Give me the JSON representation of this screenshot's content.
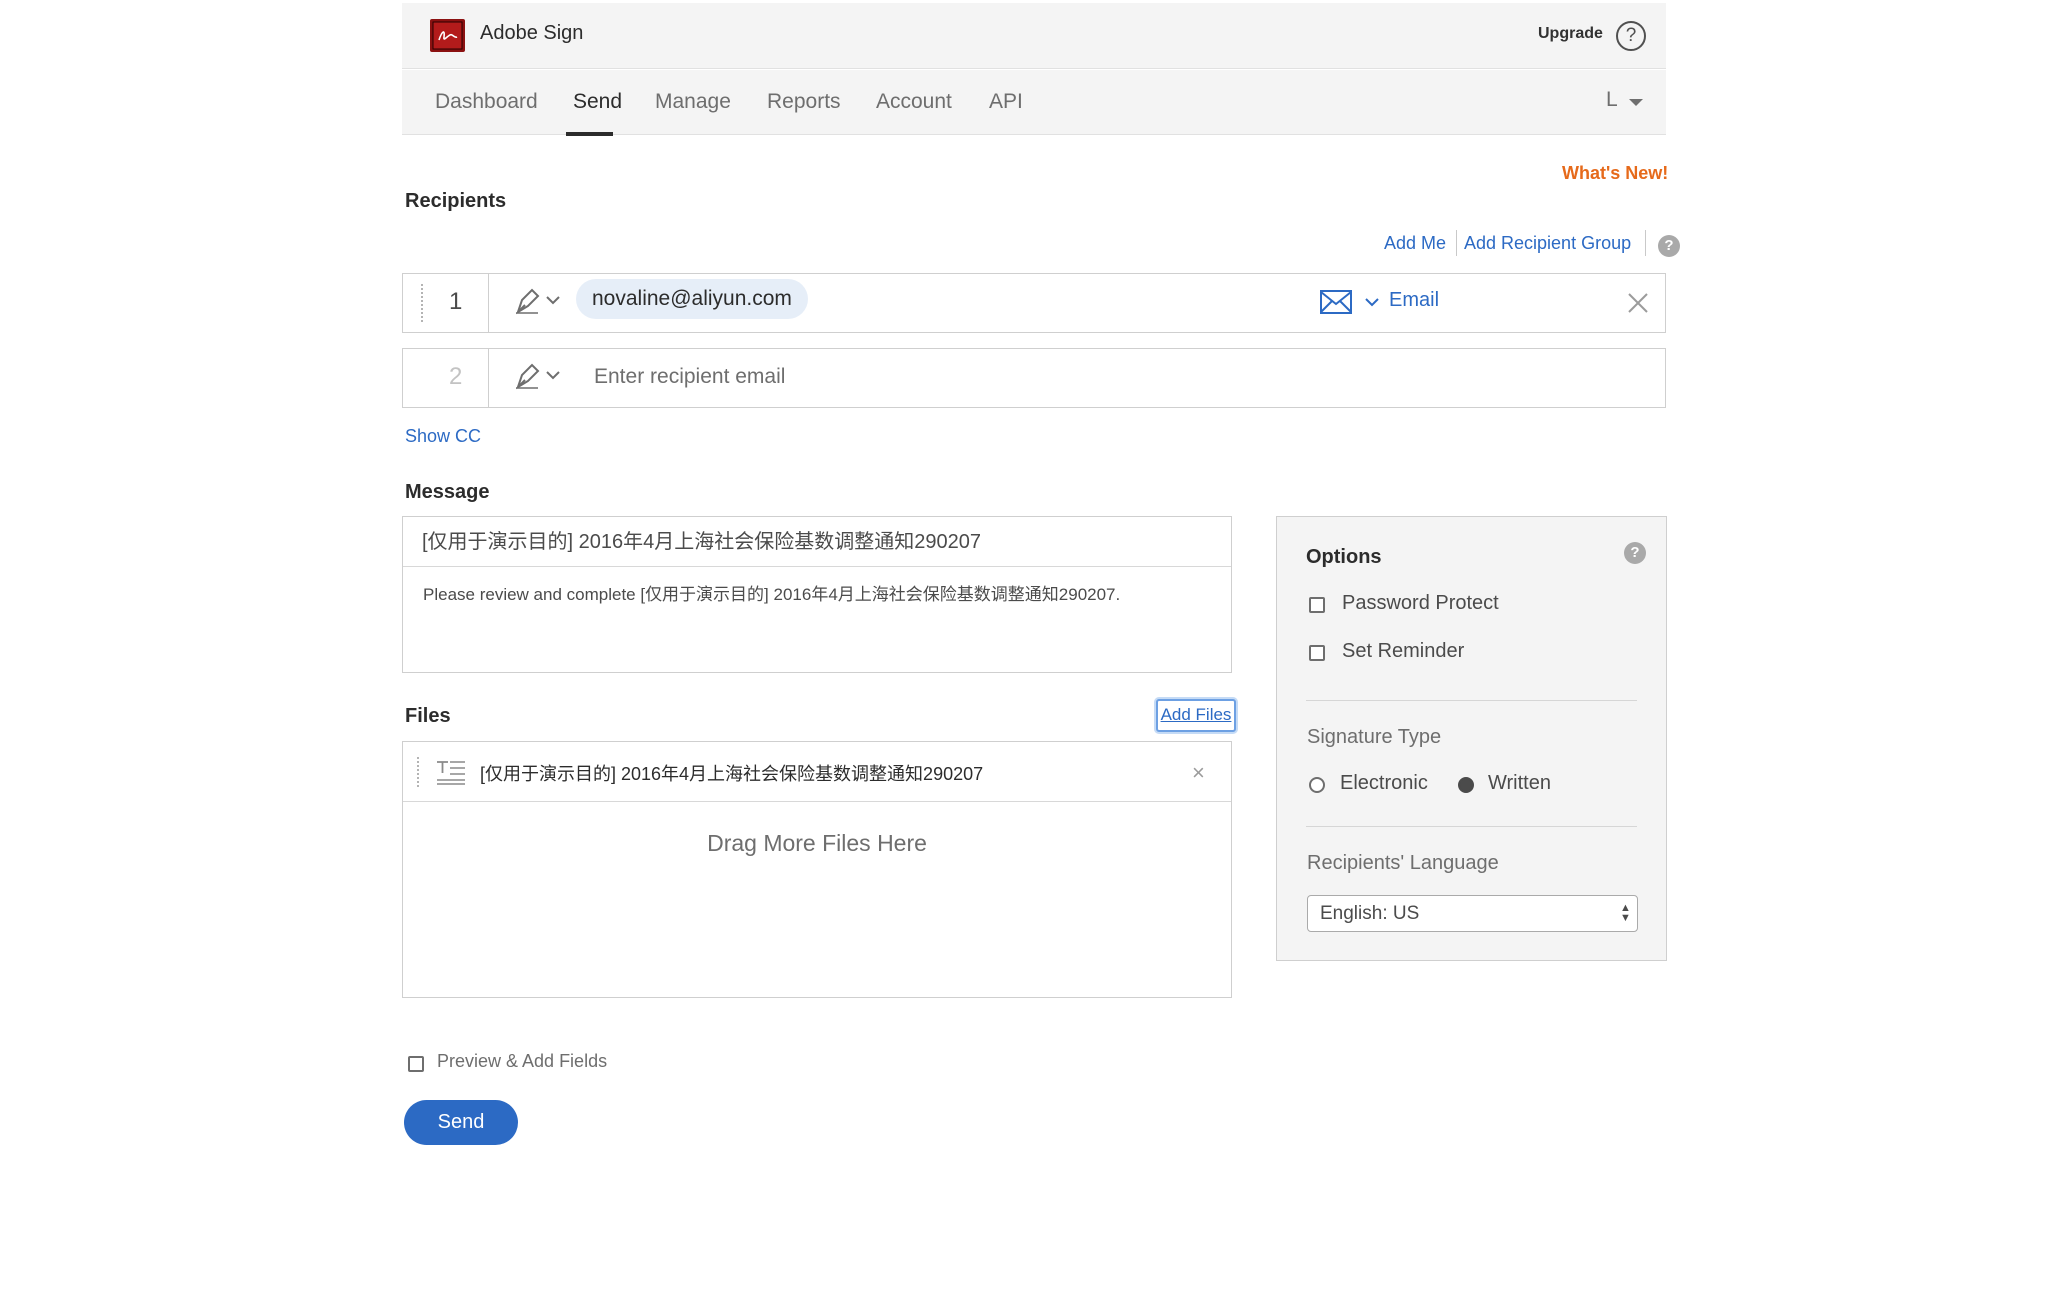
{
  "header": {
    "app_title": "Adobe Sign",
    "upgrade_label": "Upgrade",
    "help_glyph": "?"
  },
  "nav": {
    "items": [
      {
        "label": "Dashboard",
        "active": false
      },
      {
        "label": "Send",
        "active": true
      },
      {
        "label": "Manage",
        "active": false
      },
      {
        "label": "Reports",
        "active": false
      },
      {
        "label": "Account",
        "active": false
      },
      {
        "label": "API",
        "active": false
      }
    ],
    "user_initial": "L"
  },
  "whats_new": "What's New!",
  "recipients": {
    "title": "Recipients",
    "add_me": "Add Me",
    "add_group": "Add Recipient Group",
    "rows": [
      {
        "number": "1",
        "email": "novaline@aliyun.com",
        "delivery": "Email"
      },
      {
        "number": "2",
        "placeholder": "Enter recipient email"
      }
    ],
    "show_cc": "Show CC"
  },
  "message": {
    "title": "Message",
    "subject": "[仅用于演示目的] 2016年4月上海社会保险基数调整通知290207",
    "body": "Please review and complete [仅用于演示目的] 2016年4月上海社会保险基数调整通知290207."
  },
  "files": {
    "title": "Files",
    "add_files": "Add Files",
    "items": [
      {
        "name": "[仅用于演示目的] 2016年4月上海社会保险基数调整通知290207"
      }
    ],
    "remove_glyph": "×",
    "drop_hint": "Drag More Files Here"
  },
  "options": {
    "title": "Options",
    "password_protect": "Password Protect",
    "set_reminder": "Set Reminder",
    "signature_type_title": "Signature Type",
    "signature_types": [
      {
        "label": "Electronic",
        "selected": false
      },
      {
        "label": "Written",
        "selected": true
      }
    ],
    "language_title": "Recipients' Language",
    "language_value": "English: US"
  },
  "footer": {
    "preview_label": "Preview & Add Fields",
    "send_label": "Send"
  },
  "colors": {
    "accent": "#2c6ac4",
    "whats_new": "#e66a1b",
    "logo": "#8b1111"
  },
  "icons": {
    "logo": "adobe-sign-logo",
    "help": "question-circle-icon",
    "signer": "pen-icon",
    "delivery": "envelope-icon",
    "remove": "close-icon",
    "file": "document-text-icon"
  }
}
